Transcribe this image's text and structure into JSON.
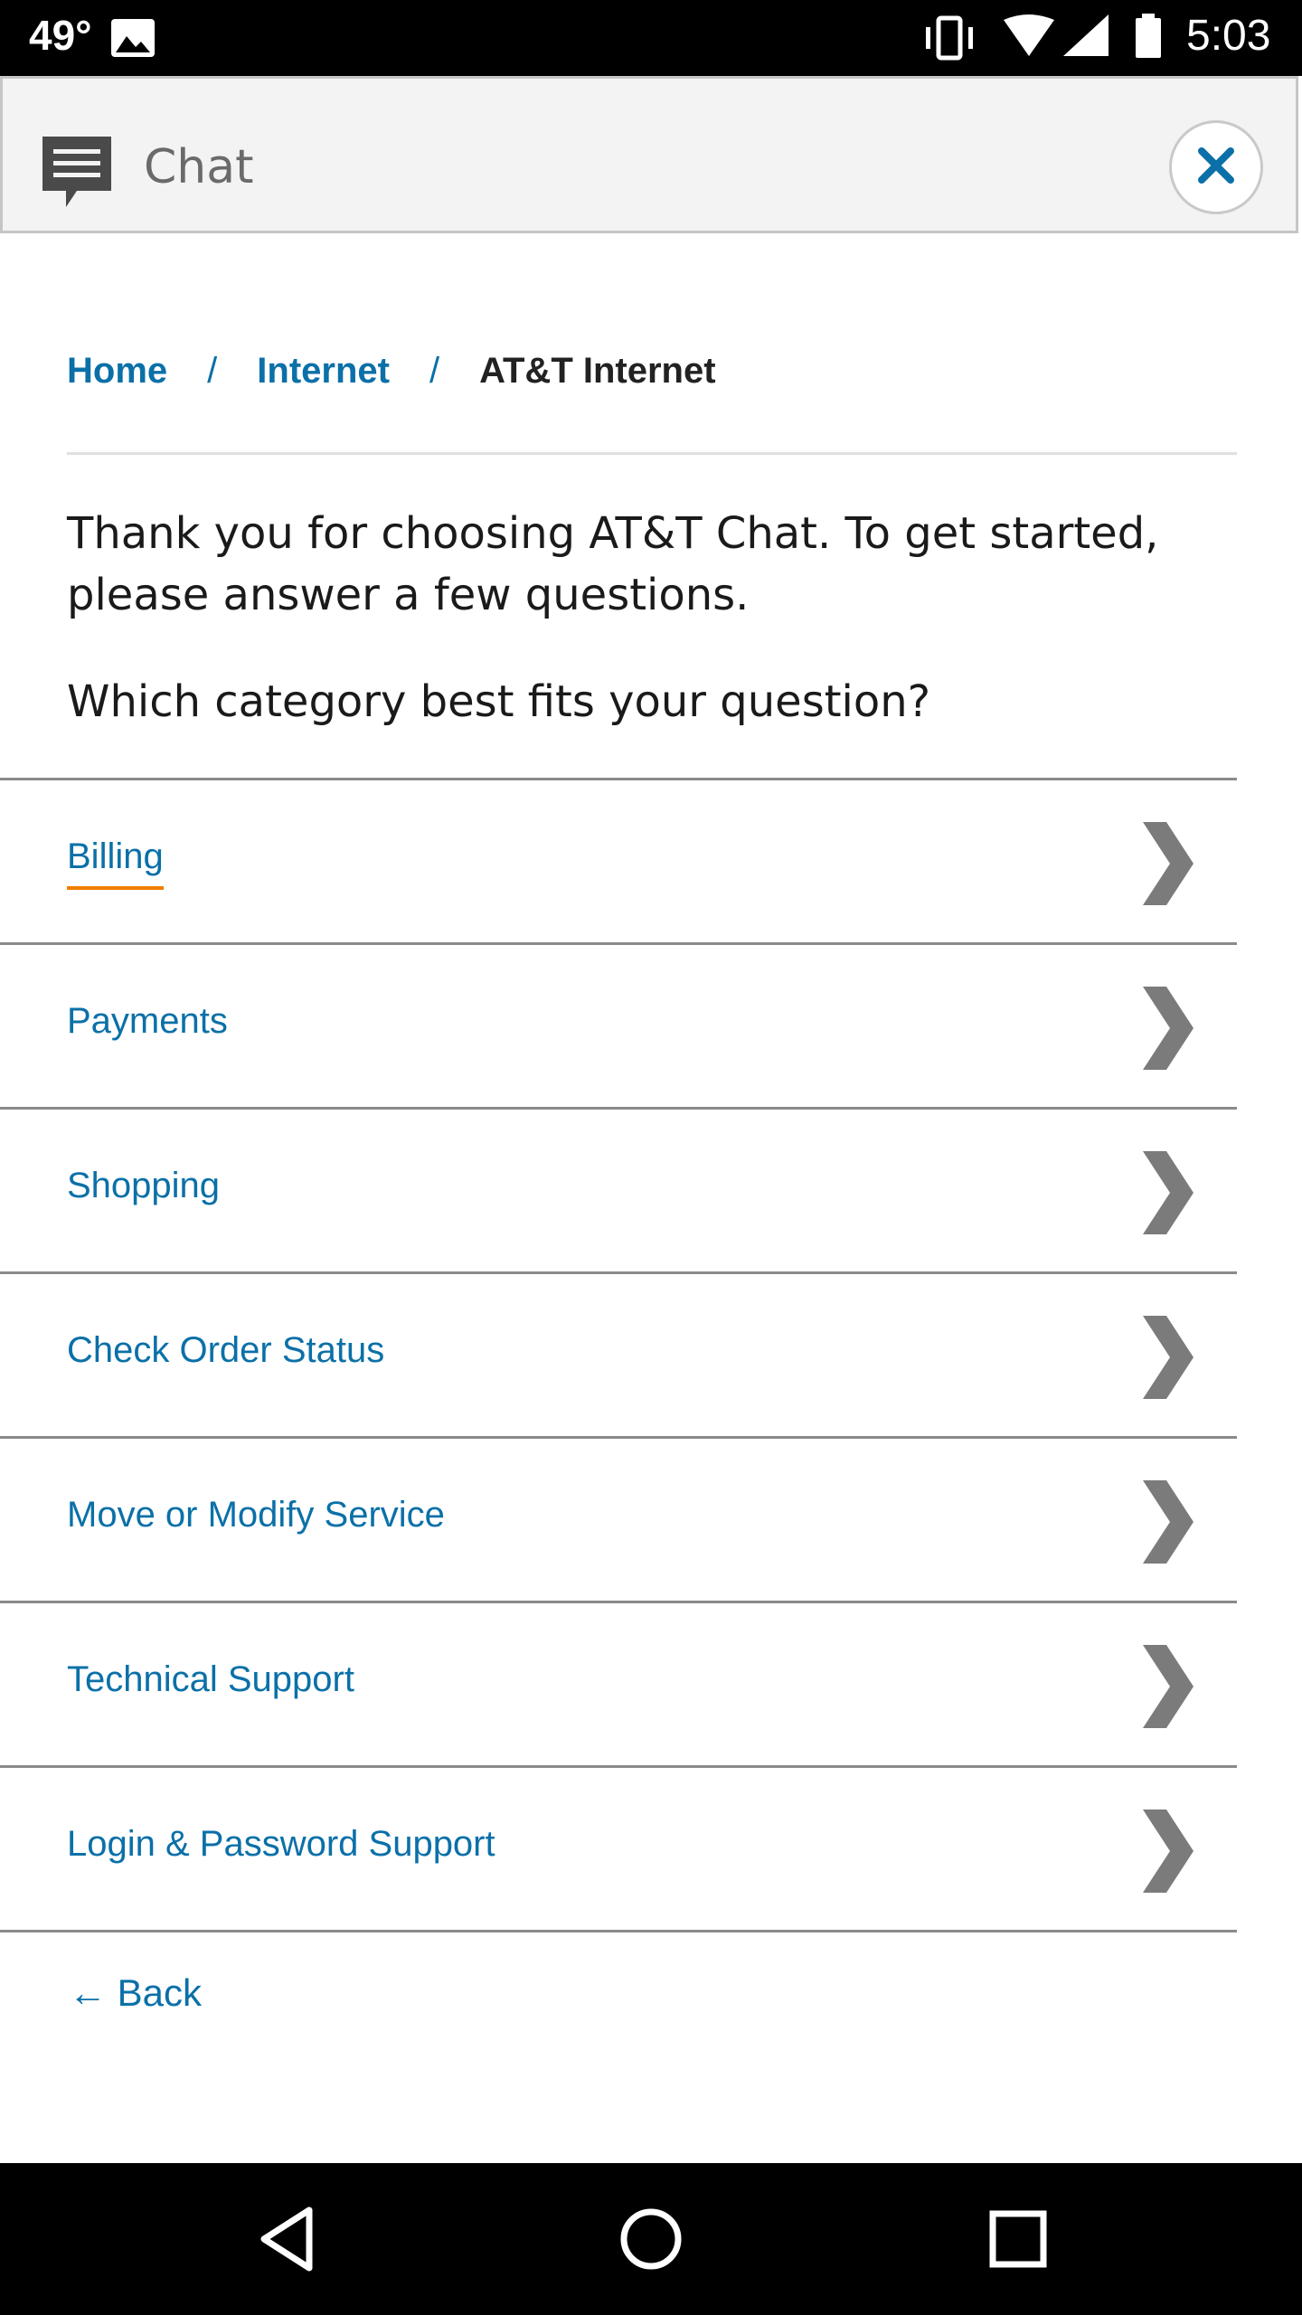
{
  "status_bar": {
    "temperature": "49°",
    "time": "5:03",
    "icons": [
      "image-icon",
      "vibrate-icon",
      "wifi-icon",
      "signal-icon",
      "battery-icon"
    ]
  },
  "header": {
    "title": "Chat",
    "icon": "chat-bubble-icon",
    "close_icon": "close-icon"
  },
  "breadcrumb": {
    "items": [
      {
        "label": "Home"
      },
      {
        "label": "Internet"
      },
      {
        "label": "AT&T Internet"
      }
    ],
    "separator": "/"
  },
  "intro": "Thank you for choosing AT&T Chat. To get started, please answer a few questions.",
  "question": "Which category best fits your question?",
  "categories": [
    {
      "label": "Billing"
    },
    {
      "label": "Payments"
    },
    {
      "label": "Shopping"
    },
    {
      "label": "Check Order Status"
    },
    {
      "label": "Move or Modify Service"
    },
    {
      "label": "Technical Support"
    },
    {
      "label": "Login & Password Support"
    }
  ],
  "back_label": "← Back",
  "nav": {
    "back_icon": "triangle-back-icon",
    "home_icon": "circle-home-icon",
    "recents_icon": "square-recents-icon"
  },
  "colors": {
    "link": "#0b70a8",
    "active_underline": "#f07d00",
    "chevron": "#7b7b7b"
  }
}
